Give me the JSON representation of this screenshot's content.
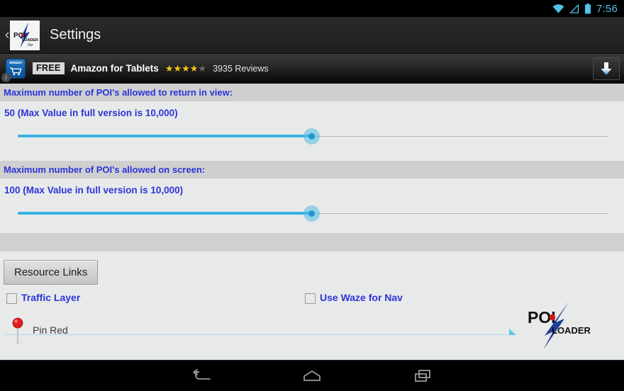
{
  "status_bar": {
    "time": "7:56",
    "icons": [
      "wifi-icon",
      "signal-icon",
      "battery-icon"
    ],
    "accent_color": "#4fc3e8"
  },
  "title_bar": {
    "back_label": "‹",
    "app_icon": "poi-loader-lite-icon",
    "title": "Settings"
  },
  "ad_banner": {
    "icon": "amazon-appstore-icon",
    "amazon_word": "amazon",
    "free_badge": "FREE",
    "title": "Amazon for Tablets",
    "stars_filled": 4,
    "stars_total": 5,
    "reviews": "3935 Reviews",
    "info_badge": "i",
    "download_icon": "download-arrow-icon"
  },
  "settings": {
    "section1": {
      "header": "Maximum number of POI's allowed to return in view:",
      "value_text": "50   (Max Value in full version is 10,000)",
      "value": 50,
      "slider_percent": 50
    },
    "section2": {
      "header": "Maximum number of POI's allowed on screen:",
      "value_text": "100   (Max Value in full version is 10,000)",
      "value": 100,
      "slider_percent": 50
    }
  },
  "lower_panel": {
    "resource_links_button": "Resource Links",
    "checkboxes": [
      {
        "label": "Traffic Layer",
        "checked": false
      },
      {
        "label": "Use Waze for Nav",
        "checked": false
      }
    ],
    "pin": {
      "icon": "map-pin-red-icon",
      "label": "Pin Red"
    },
    "logo": {
      "text_top": "POI",
      "text_bottom": "LOADER"
    }
  },
  "nav_bar": {
    "buttons": [
      "back-icon",
      "home-icon",
      "recents-icon"
    ]
  },
  "colors": {
    "link_blue": "#2b35d8",
    "slider_blue": "#39b3e3",
    "header_gray": "#cfcfcf",
    "content_gray": "#e8eae9"
  }
}
